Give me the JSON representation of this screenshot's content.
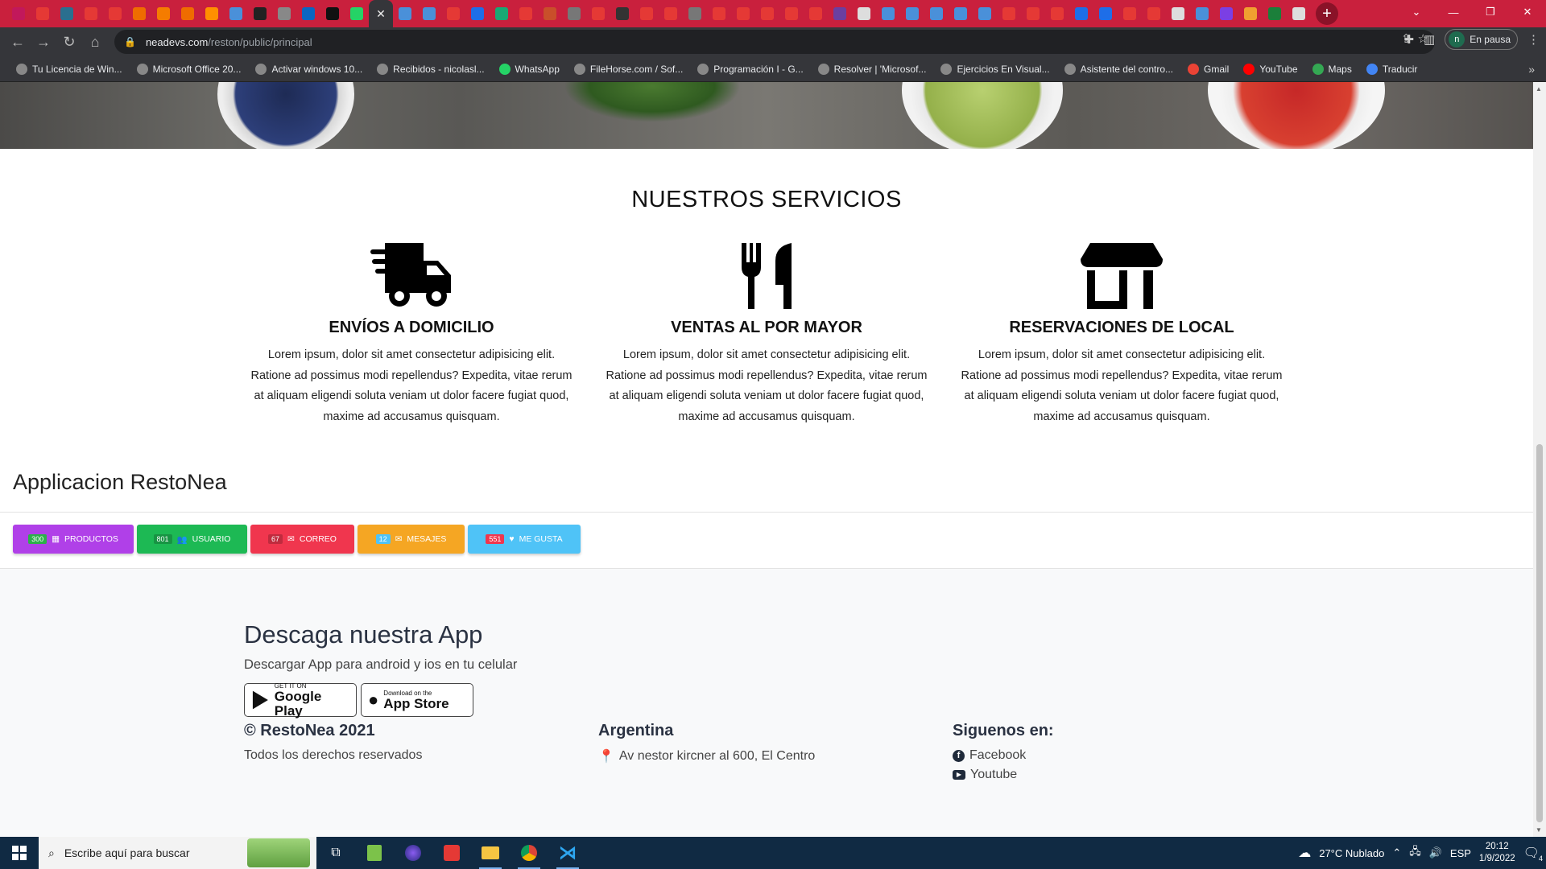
{
  "browser": {
    "url_host": "neadevs.com",
    "url_path": "/reston/public/principal",
    "profile_label": "En pausa",
    "profile_initial": "n",
    "tab_colors": [
      "#c2185b",
      "#e53935",
      "#2a6f8f",
      "#e53935",
      "#e53935",
      "#ef6c00",
      "#f57c00",
      "#ef6c00",
      "#ff8f00",
      "#4a90d9",
      "#222",
      "#888",
      "#0a66c2",
      "#111",
      "#25d366",
      "#35363a",
      "#4a90d9",
      "#4a90d9",
      "#e53935",
      "#1e6ee8",
      "#19a974",
      "#e53935",
      "#c94f2a",
      "#777",
      "#e53935",
      "#333",
      "#e53935",
      "#e53935",
      "#777",
      "#e53935",
      "#e53935",
      "#e53935",
      "#e53935",
      "#e53935",
      "#6b3fa0",
      "#ddd",
      "#4a90d9",
      "#4a90d9",
      "#4a90d9",
      "#4a90d9",
      "#4a90d9",
      "#e53935",
      "#e53935",
      "#e53935",
      "#1e6ee8",
      "#1e6ee8",
      "#e53935",
      "#e53935",
      "#ddd",
      "#4a90d9",
      "#7b3fe4",
      "#f0a030",
      "#1b7f3a",
      "#ddd"
    ],
    "bookmarks": [
      {
        "label": "Tu Licencia de Win...",
        "color": "#888"
      },
      {
        "label": "Microsoft Office 20...",
        "color": "#888"
      },
      {
        "label": "Activar windows 10...",
        "color": "#888"
      },
      {
        "label": "Recibidos - nicolasl...",
        "color": "#888"
      },
      {
        "label": "WhatsApp",
        "color": "#25d366"
      },
      {
        "label": "FileHorse.com / Sof...",
        "color": "#888"
      },
      {
        "label": "Programación I - G...",
        "color": "#888"
      },
      {
        "label": "Resolver | 'Microsof...",
        "color": "#888"
      },
      {
        "label": "Ejercicios En Visual...",
        "color": "#888"
      },
      {
        "label": "Asistente del contro...",
        "color": "#888"
      },
      {
        "label": "Gmail",
        "color": "#ea4335"
      },
      {
        "label": "YouTube",
        "color": "#ff0000"
      },
      {
        "label": "Maps",
        "color": "#34a853"
      },
      {
        "label": "Traducir",
        "color": "#4285f4"
      }
    ]
  },
  "services": {
    "title": "NUESTROS SERVICIOS",
    "items": [
      {
        "name": "ENVÍOS A DOMICILIO",
        "text": "Lorem ipsum, dolor sit amet consectetur adipisicing elit. Ratione ad possimus modi repellendus? Expedita, vitae rerum at aliquam eligendi soluta veniam ut dolor facere fugiat quod, maxime ad accusamus quisquam.",
        "icon": "truck-icon"
      },
      {
        "name": "VENTAS AL POR MAYOR",
        "text": "Lorem ipsum, dolor sit amet consectetur adipisicing elit. Ratione ad possimus modi repellendus? Expedita, vitae rerum at aliquam eligendi soluta veniam ut dolor facere fugiat quod, maxime ad accusamus quisquam.",
        "icon": "utensils-icon"
      },
      {
        "name": "RESERVACIONES DE LOCAL",
        "text": "Lorem ipsum, dolor sit amet consectetur adipisicing elit. Ratione ad possimus modi repellendus? Expedita, vitae rerum at aliquam eligendi soluta veniam ut dolor facere fugiat quod, maxime ad accusamus quisquam.",
        "icon": "store-icon"
      }
    ]
  },
  "app": {
    "title": "Applicacion RestoNea",
    "buttons": [
      {
        "count": "300",
        "label": "PRODUCTOS",
        "color": "#b040e8",
        "icon": "grid-icon"
      },
      {
        "count": "801",
        "label": "USUARIO",
        "color": "#1db954",
        "icon": "users-icon"
      },
      {
        "count": "67",
        "label": "CORREO",
        "color": "#f0364e",
        "icon": "mailbox-icon"
      },
      {
        "count": "12",
        "label": "MESAJES",
        "color": "#f5a623",
        "icon": "envelope-icon"
      },
      {
        "count": "551",
        "label": "ME GUSTA",
        "color": "#4fc3f7",
        "icon": "heart-icon"
      }
    ]
  },
  "footer": {
    "heading": "Descaga nuestra App",
    "subtitle": "Descargar App para android y ios en tu celular",
    "google_small": "GET IT ON",
    "google_big": "Google Play",
    "apple_small": "Download on the",
    "apple_big": "App Store",
    "copyright": "© RestoNea 2021",
    "rights": "Todos los derechos reservados",
    "country": "Argentina",
    "address": "Av nestor kircner al 600, El Centro",
    "follow": "Siguenos en:",
    "facebook": "Facebook",
    "youtube": "Youtube"
  },
  "taskbar": {
    "search_placeholder": "Escribe aquí para buscar",
    "weather": "27°C  Nublado",
    "lang": "ESP",
    "time": "20:12",
    "date": "1/9/2022",
    "notif_count": "4"
  }
}
